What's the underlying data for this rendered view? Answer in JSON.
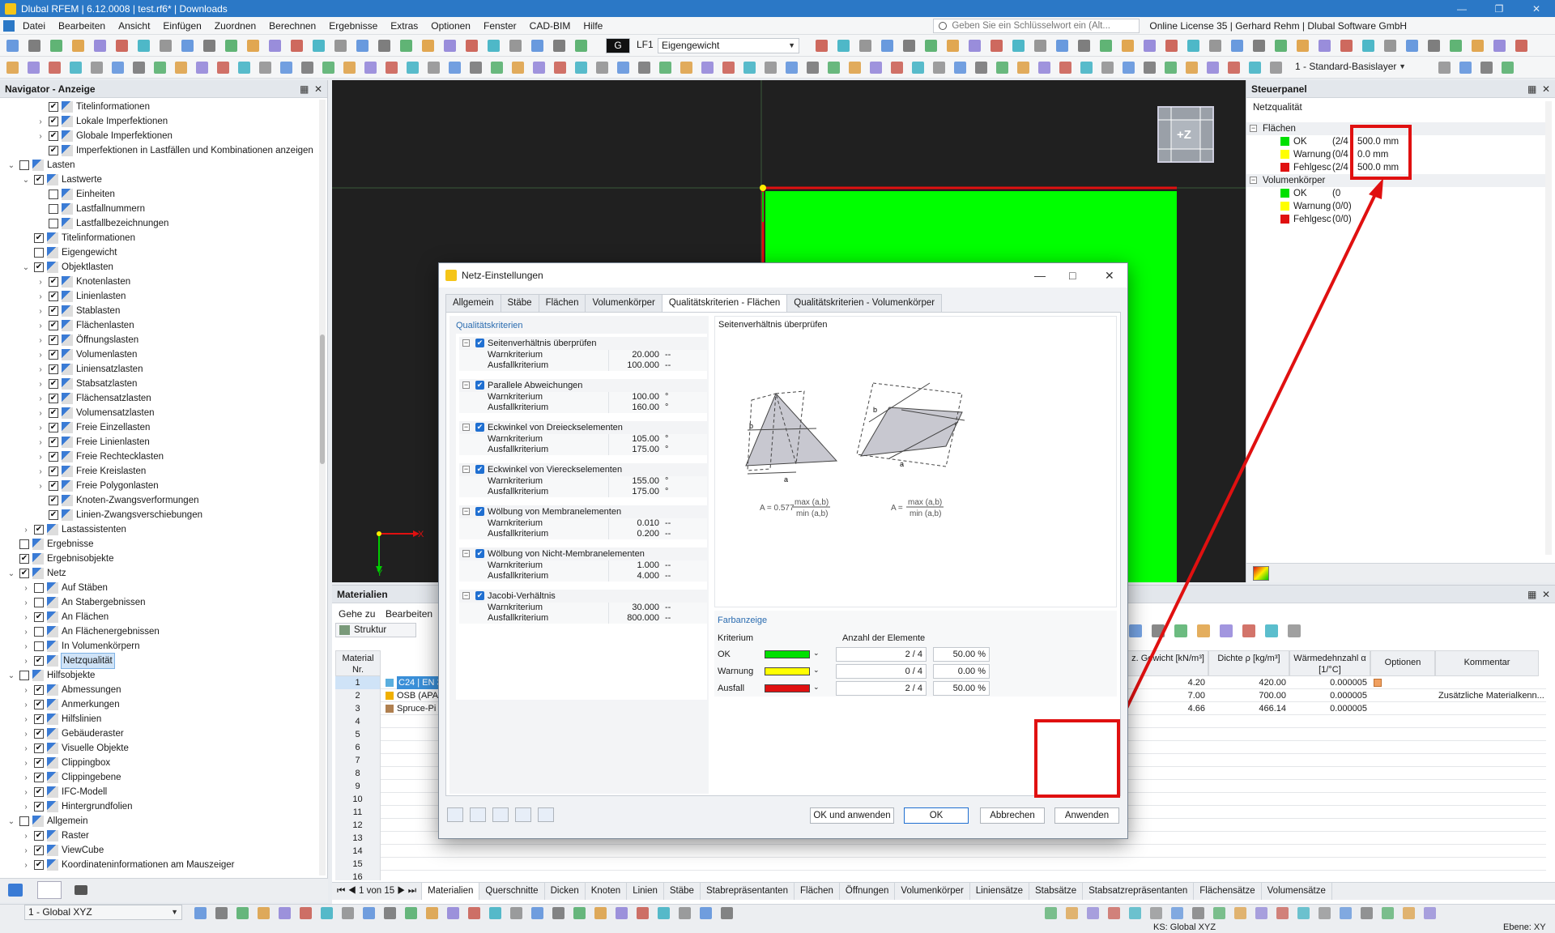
{
  "window": {
    "title": "Dlubal RFEM | 6.12.0008 | test.rf6* | Downloads"
  },
  "menu": {
    "items": [
      "Datei",
      "Bearbeiten",
      "Ansicht",
      "Einfügen",
      "Zuordnen",
      "Berechnen",
      "Ergebnisse",
      "Extras",
      "Optionen",
      "Fenster",
      "CAD-BIM",
      "Hilfe"
    ],
    "search_placeholder": "Geben Sie ein Schlüsselwort ein (Alt...",
    "license": "Online License 35 | Gerhard Rehm | Dlubal Software GmbH"
  },
  "toolbar": {
    "lc_code": "G",
    "lc_id": "LF1",
    "lc_name": "Eigengewicht",
    "layer": "1 - Standard-Basislayer"
  },
  "navigator": {
    "title": "Navigator - Anzeige",
    "items": [
      {
        "d": 2,
        "exp": "",
        "c": "x",
        "l": "Titelinformationen"
      },
      {
        "d": 2,
        "exp": ">",
        "c": "x",
        "l": "Lokale Imperfektionen"
      },
      {
        "d": 2,
        "exp": ">",
        "c": "x",
        "l": "Globale Imperfektionen"
      },
      {
        "d": 2,
        "exp": "",
        "c": "x",
        "l": "Imperfektionen in Lastfällen und Kombinationen anzeigen"
      },
      {
        "d": 0,
        "exp": "v",
        "c": "",
        "l": "Lasten"
      },
      {
        "d": 1,
        "exp": "v",
        "c": "x",
        "l": "Lastwerte"
      },
      {
        "d": 2,
        "exp": "",
        "c": "",
        "l": "Einheiten"
      },
      {
        "d": 2,
        "exp": "",
        "c": "",
        "l": "Lastfallnummern"
      },
      {
        "d": 2,
        "exp": "",
        "c": "",
        "l": "Lastfallbezeichnungen"
      },
      {
        "d": 1,
        "exp": "",
        "c": "x",
        "l": "Titelinformationen"
      },
      {
        "d": 1,
        "exp": "",
        "c": "",
        "l": "Eigengewicht"
      },
      {
        "d": 1,
        "exp": "v",
        "c": "x",
        "l": "Objektlasten"
      },
      {
        "d": 2,
        "exp": ">",
        "c": "x",
        "l": "Knotenlasten"
      },
      {
        "d": 2,
        "exp": ">",
        "c": "x",
        "l": "Linienlasten"
      },
      {
        "d": 2,
        "exp": ">",
        "c": "x",
        "l": "Stablasten"
      },
      {
        "d": 2,
        "exp": ">",
        "c": "x",
        "l": "Flächenlasten"
      },
      {
        "d": 2,
        "exp": ">",
        "c": "x",
        "l": "Öffnungslasten"
      },
      {
        "d": 2,
        "exp": ">",
        "c": "x",
        "l": "Volumenlasten"
      },
      {
        "d": 2,
        "exp": ">",
        "c": "x",
        "l": "Liniensatzlasten"
      },
      {
        "d": 2,
        "exp": ">",
        "c": "x",
        "l": "Stabsatzlasten"
      },
      {
        "d": 2,
        "exp": ">",
        "c": "x",
        "l": "Flächensatzlasten"
      },
      {
        "d": 2,
        "exp": ">",
        "c": "x",
        "l": "Volumensatzlasten"
      },
      {
        "d": 2,
        "exp": ">",
        "c": "x",
        "l": "Freie Einzellasten"
      },
      {
        "d": 2,
        "exp": ">",
        "c": "x",
        "l": "Freie Linienlasten"
      },
      {
        "d": 2,
        "exp": ">",
        "c": "x",
        "l": "Freie Rechtecklasten"
      },
      {
        "d": 2,
        "exp": ">",
        "c": "x",
        "l": "Freie Kreislasten"
      },
      {
        "d": 2,
        "exp": ">",
        "c": "x",
        "l": "Freie Polygonlasten"
      },
      {
        "d": 2,
        "exp": "",
        "c": "x",
        "l": "Knoten-Zwangsverformungen"
      },
      {
        "d": 2,
        "exp": "",
        "c": "x",
        "l": "Linien-Zwangsverschiebungen"
      },
      {
        "d": 1,
        "exp": ">",
        "c": "x",
        "l": "Lastassistenten"
      },
      {
        "d": 0,
        "exp": "",
        "c": "",
        "l": "Ergebnisse"
      },
      {
        "d": 0,
        "exp": "",
        "c": "x",
        "l": "Ergebnisobjekte"
      },
      {
        "d": 0,
        "exp": "v",
        "c": "x",
        "l": "Netz"
      },
      {
        "d": 1,
        "exp": ">",
        "c": "",
        "l": "Auf Stäben"
      },
      {
        "d": 1,
        "exp": ">",
        "c": "",
        "l": "An Stabergebnissen"
      },
      {
        "d": 1,
        "exp": ">",
        "c": "x",
        "l": "An Flächen"
      },
      {
        "d": 1,
        "exp": ">",
        "c": "",
        "l": "An Flächenergebnissen"
      },
      {
        "d": 1,
        "exp": ">",
        "c": "",
        "l": "In Volumenkörpern"
      },
      {
        "d": 1,
        "exp": ">",
        "c": "x",
        "l": "Netzqualität",
        "sel": true
      },
      {
        "d": 0,
        "exp": "v",
        "c": "",
        "l": "Hilfsobjekte"
      },
      {
        "d": 1,
        "exp": ">",
        "c": "x",
        "l": "Abmessungen"
      },
      {
        "d": 1,
        "exp": ">",
        "c": "x",
        "l": "Anmerkungen"
      },
      {
        "d": 1,
        "exp": ">",
        "c": "x",
        "l": "Hilfslinien"
      },
      {
        "d": 1,
        "exp": ">",
        "c": "x",
        "l": "Gebäuderaster"
      },
      {
        "d": 1,
        "exp": ">",
        "c": "x",
        "l": "Visuelle Objekte"
      },
      {
        "d": 1,
        "exp": ">",
        "c": "x",
        "l": "Clippingbox"
      },
      {
        "d": 1,
        "exp": ">",
        "c": "x",
        "l": "Clippingebene"
      },
      {
        "d": 1,
        "exp": ">",
        "c": "x",
        "l": "IFC-Modell"
      },
      {
        "d": 1,
        "exp": ">",
        "c": "x",
        "l": "Hintergrundfolien"
      },
      {
        "d": 0,
        "exp": "v",
        "c": "",
        "l": "Allgemein"
      },
      {
        "d": 1,
        "exp": ">",
        "c": "x",
        "l": "Raster"
      },
      {
        "d": 1,
        "exp": ">",
        "c": "x",
        "l": "ViewCube"
      },
      {
        "d": 1,
        "exp": ">",
        "c": "x",
        "l": "Koordinateninformationen am Mauszeiger"
      }
    ]
  },
  "viewport": {
    "axis_x": "X",
    "axis_y": "Y",
    "viewcube": "+Z"
  },
  "steuer": {
    "title": "Steuerpanel",
    "subtitle": "Netzqualität",
    "groups": [
      {
        "name": "Flächen",
        "rows": [
          {
            "l": "OK",
            "n": "(2/4",
            "v": "500.0 mm",
            "c": "#00e000"
          },
          {
            "l": "Warnung",
            "n": "(0/4",
            "v": "0.0 mm",
            "c": "#ffff00"
          },
          {
            "l": "Fehlgesch",
            "n": "(2/4",
            "v": "500.0 mm",
            "c": "#e01010"
          }
        ]
      },
      {
        "name": "Volumenkörper",
        "rows": [
          {
            "l": "OK",
            "n": "(0",
            "v": "",
            "c": "#00e000"
          },
          {
            "l": "Warnung",
            "n": "(0/0)",
            "v": "",
            "c": "#ffff00"
          },
          {
            "l": "Fehlgesch",
            "n": "(0/0)",
            "v": "",
            "c": "#e01010"
          }
        ]
      }
    ]
  },
  "materials": {
    "title": "Materialien",
    "menu": [
      "Gehe zu",
      "Bearbeiten"
    ],
    "combo": "Struktur",
    "headers": {
      "nr": "Material Nr.",
      "gewicht": "z. Gewicht [kN/m³]",
      "dichte": "Dichte ρ [kg/m³]",
      "waerme": "Wärmedehnzahl α [1/°C]",
      "optionen": "Optionen",
      "kommentar": "Kommentar"
    },
    "rows": [
      {
        "nr": "1",
        "name": "C24 | EN 3",
        "g": "4.20",
        "d": "420.00",
        "w": "0.000005",
        "k": "",
        "col": "#5aaede"
      },
      {
        "nr": "2",
        "name": "OSB (APA",
        "g": "7.00",
        "d": "700.00",
        "w": "0.000005",
        "k": "Zusätzliche Materialkenn...",
        "col": "#f0b000"
      },
      {
        "nr": "3",
        "name": "Spruce-Pi",
        "g": "4.66",
        "d": "466.14",
        "w": "0.000005",
        "k": "",
        "col": "#b08050"
      },
      {
        "nr": "4"
      },
      {
        "nr": "5"
      },
      {
        "nr": "6"
      },
      {
        "nr": "7"
      },
      {
        "nr": "8"
      },
      {
        "nr": "9"
      },
      {
        "nr": "10"
      },
      {
        "nr": "11"
      },
      {
        "nr": "12"
      },
      {
        "nr": "13"
      },
      {
        "nr": "14"
      },
      {
        "nr": "15"
      },
      {
        "nr": "16"
      }
    ],
    "pager": "1 von 15",
    "tabs": [
      "Materialien",
      "Querschnitte",
      "Dicken",
      "Knoten",
      "Linien",
      "Stäbe",
      "Stabrepräsentanten",
      "Flächen",
      "Öffnungen",
      "Volumenkörper",
      "Liniensätze",
      "Stabsätze",
      "Stabsatzrepräsentanten",
      "Flächensätze",
      "Volumensätze"
    ]
  },
  "status": {
    "cs": "1 - Global XYZ",
    "ks": "KS: Global XYZ",
    "ebene": "Ebene: XY"
  },
  "dialog": {
    "title": "Netz-Einstellungen",
    "tabs": [
      "Allgemein",
      "Stäbe",
      "Flächen",
      "Volumenkörper",
      "Qualitätskriterien - Flächen",
      "Qualitätskriterien - Volumenkörper"
    ],
    "criteria_title": "Qualitätskriterien",
    "criteria": [
      {
        "name": "Seitenverhältnis überprüfen",
        "warn": "20.000",
        "fail": "100.000",
        "unit": "--"
      },
      {
        "name": "Parallele Abweichungen",
        "warn": "100.00",
        "fail": "160.00",
        "unit": "°"
      },
      {
        "name": "Eckwinkel von Dreieckselementen",
        "warn": "105.00",
        "fail": "175.00",
        "unit": "°"
      },
      {
        "name": "Eckwinkel von Viereckselementen",
        "warn": "155.00",
        "fail": "175.00",
        "unit": "°"
      },
      {
        "name": "Wölbung von Membranelementen",
        "warn": "0.010",
        "fail": "0.200",
        "unit": "--"
      },
      {
        "name": "Wölbung von Nicht-Membranelementen",
        "warn": "1.000",
        "fail": "4.000",
        "unit": "--"
      },
      {
        "name": "Jacobi-Verhältnis",
        "warn": "30.000",
        "fail": "800.000",
        "unit": "--"
      }
    ],
    "warn_label": "Warnkriterium",
    "fail_label": "Ausfallkriterium",
    "figure_title": "Seitenverhältnis überprüfen",
    "formula1_prefix": "A = 0.577",
    "formula2_prefix": "A =",
    "formula_num": "max (a,b)",
    "formula_den": "min (a,b)",
    "fig_a": "a",
    "fig_b": "b",
    "farb": {
      "title": "Farbanzeige",
      "col_kriterium": "Kriterium",
      "col_anzahl": "Anzahl der Elemente",
      "rows": [
        {
          "l": "OK",
          "c": "#00e000",
          "n": "2 / 4",
          "p": "50.00 %"
        },
        {
          "l": "Warnung",
          "c": "#ffff00",
          "n": "0 / 4",
          "p": "0.00 %"
        },
        {
          "l": "Ausfall",
          "c": "#e01010",
          "n": "2 / 4",
          "p": "50.00 %"
        }
      ]
    },
    "buttons": {
      "apply_ok": "OK und anwenden",
      "ok": "OK",
      "cancel": "Abbrechen",
      "apply": "Anwenden"
    }
  },
  "colors": {
    "accent": "#2b78c6",
    "ok": "#00e000",
    "warn": "#ffff00",
    "fail": "#e01010",
    "highlight": "#e01010"
  }
}
